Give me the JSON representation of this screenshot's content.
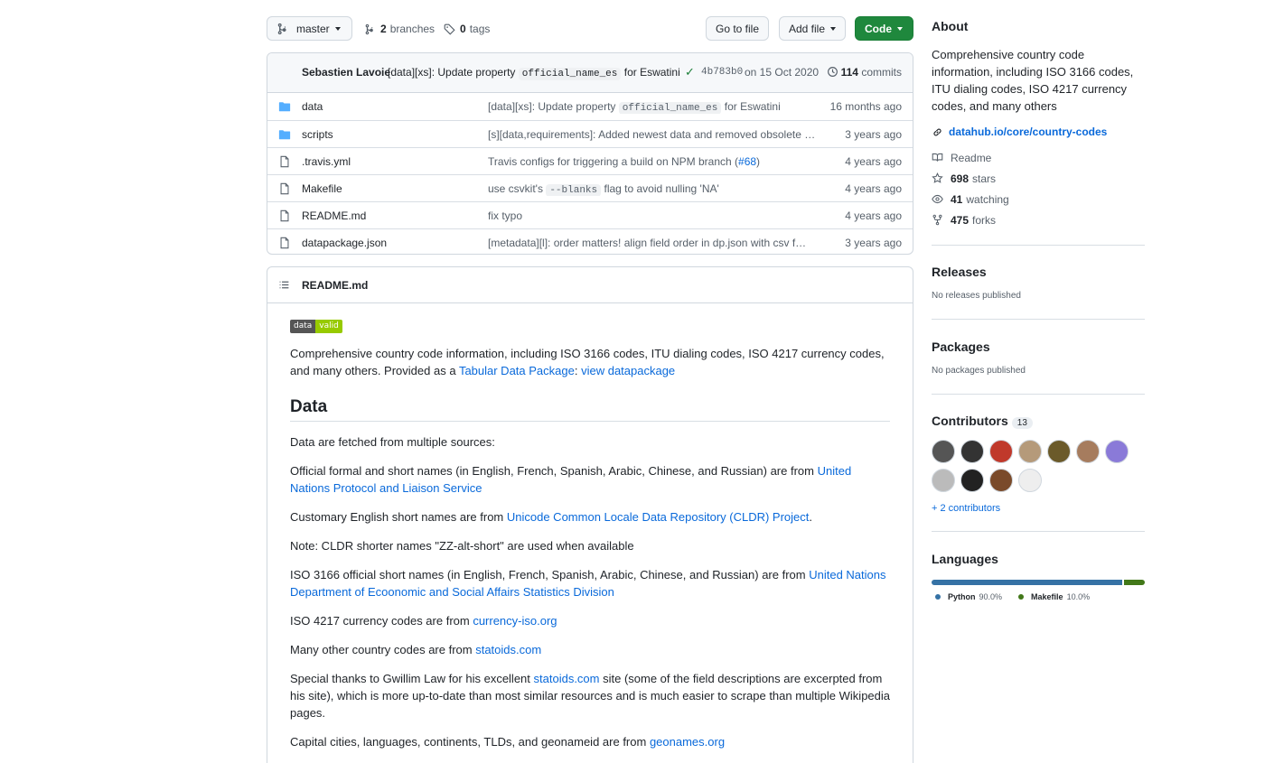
{
  "toolbar": {
    "branch": "master",
    "branches_count": "2",
    "branches_label": "branches",
    "tags_count": "0",
    "tags_label": "tags",
    "go_to_file": "Go to file",
    "add_file": "Add file",
    "code": "Code"
  },
  "commit": {
    "author": "Sebastien Lavoie",
    "message_prefix": "[data][xs]: Update property",
    "message_code": "official_name_es",
    "message_suffix": "for Eswatini",
    "sha": "4b783b0",
    "date": "on 15 Oct 2020",
    "commits_count": "114",
    "commits_label": "commits"
  },
  "files": [
    {
      "name": "data",
      "type": "folder",
      "msg_prefix": "[data][xs]: Update property",
      "msg_code": "official_name_es",
      "msg_suffix": "for Eswatini",
      "age": "16 months ago"
    },
    {
      "name": "scripts",
      "type": "folder",
      "msg_prefix": "[s][data,requirements]: Added newest data and removed obsolete pa…",
      "msg_code": "",
      "msg_suffix": "",
      "age": "3 years ago"
    },
    {
      "name": ".travis.yml",
      "type": "file",
      "msg_prefix": "Travis configs for triggering a build on NPM branch (",
      "msg_link": "#68",
      "msg_suffix": ")",
      "age": "4 years ago"
    },
    {
      "name": "Makefile",
      "type": "file",
      "msg_prefix": "use csvkit's",
      "msg_code": "--blanks",
      "msg_suffix": "flag to avoid nulling 'NA'",
      "age": "4 years ago"
    },
    {
      "name": "README.md",
      "type": "file",
      "msg_prefix": "fix typo",
      "msg_code": "",
      "msg_suffix": "",
      "age": "4 years ago"
    },
    {
      "name": "datapackage.json",
      "type": "file",
      "msg_prefix": "[metadata][l]: order matters! align field order in dp.json with csv f…",
      "msg_code": "",
      "msg_suffix": "",
      "age": "3 years ago"
    }
  ],
  "readme": {
    "title": "README.md",
    "badge_left": "data",
    "badge_right": "valid",
    "intro_text": "Comprehensive country code information, including ISO 3166 codes, ITU dialing codes, ISO 4217 currency codes, and many others. Provided as a ",
    "intro_link1": "Tabular Data Package",
    "intro_sep": ": ",
    "intro_link2": "view datapackage",
    "h_data": "Data",
    "p1": "Data are fetched from multiple sources:",
    "p2_text": "Official formal and short names (in English, French, Spanish, Arabic, Chinese, and Russian) are from ",
    "p2_link": "United Nations Protocol and Liaison Service",
    "p3_text": "Customary English short names are from ",
    "p3_link": "Unicode Common Locale Data Repository (CLDR) Project",
    "p3_end": ".",
    "p4": "Note: CLDR shorter names \"ZZ-alt-short\" are used when available",
    "p5_text": "ISO 3166 official short names (in English, French, Spanish, Arabic, Chinese, and Russian) are from ",
    "p5_link": "United Nations Department of Ecoonomic and Social Affairs Statistics Division",
    "p6_text": "ISO 4217 currency codes are from ",
    "p6_link": "currency-iso.org",
    "p7_text": "Many other country codes are from ",
    "p7_link": "statoids.com",
    "p8_text": "Special thanks to Gwillim Law for his excellent ",
    "p8_link": "statoids.com",
    "p8_rest": " site (some of the field descriptions are excerpted from his site), which is more up-to-date than most similar resources and is much easier to scrape than multiple Wikipedia pages.",
    "p9_text": "Capital cities, languages, continents, TLDs, and geonameid are from ",
    "p9_link": "geonames.org"
  },
  "sidebar": {
    "about_title": "About",
    "about_desc": "Comprehensive country code information, including ISO 3166 codes, ITU dialing codes, ISO 4217 currency codes, and many others",
    "homepage": "datahub.io/core/country-codes",
    "readme_label": "Readme",
    "stars_count": "698",
    "stars_label": "stars",
    "watching_count": "41",
    "watching_label": "watching",
    "forks_count": "475",
    "forks_label": "forks",
    "releases_title": "Releases",
    "releases_empty": "No releases published",
    "packages_title": "Packages",
    "packages_empty": "No packages published",
    "contributors_title": "Contributors",
    "contributors_count": "13",
    "more_contributors": "+ 2 contributors",
    "languages_title": "Languages",
    "languages": [
      {
        "name": "Python",
        "percent": "90.0%",
        "value": 90.0,
        "color": "#3572A5"
      },
      {
        "name": "Makefile",
        "percent": "10.0%",
        "value": 10.0,
        "color": "#427819"
      }
    ],
    "avatar_colors": [
      "#555555",
      "#333333",
      "#c0392b",
      "#b59a7a",
      "#6b5a2a",
      "#a67c5e",
      "#8a7ad8",
      "#bbbbbb",
      "#222222",
      "#7a4a2a",
      "#eeeeee"
    ]
  }
}
